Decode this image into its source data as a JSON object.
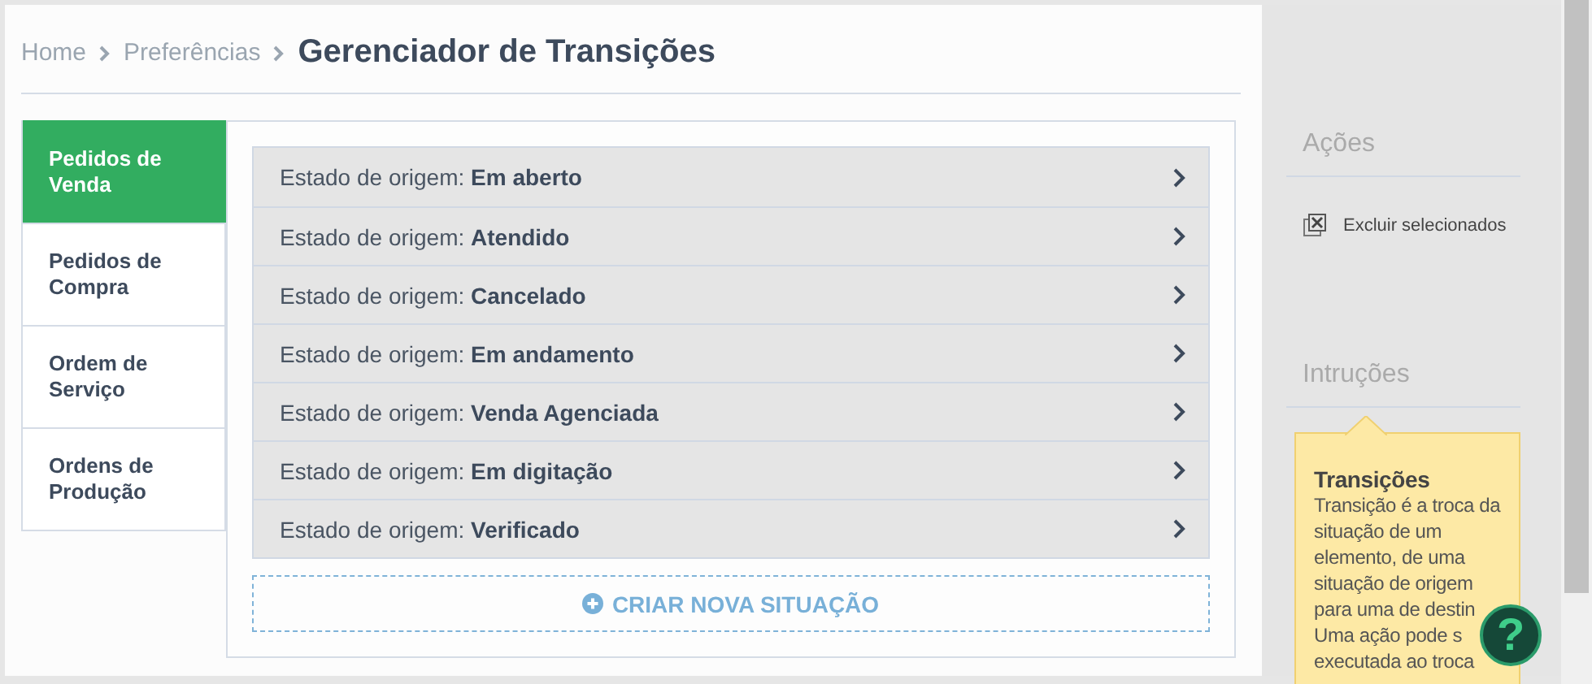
{
  "breadcrumb": {
    "items": [
      "Home",
      "Preferências"
    ],
    "title": "Gerenciador de Transições"
  },
  "tabs": [
    {
      "label": "Pedidos de Venda",
      "selected": true
    },
    {
      "label": "Pedidos de Compra",
      "selected": false
    },
    {
      "label": "Ordem de Serviço",
      "selected": false
    },
    {
      "label": "Ordens de Produção",
      "selected": false
    }
  ],
  "states": [
    {
      "prefix": "Estado de origem:",
      "name": "Em aberto"
    },
    {
      "prefix": "Estado de origem:",
      "name": "Atendido"
    },
    {
      "prefix": "Estado de origem:",
      "name": "Cancelado"
    },
    {
      "prefix": "Estado de origem:",
      "name": "Em andamento"
    },
    {
      "prefix": "Estado de origem:",
      "name": "Venda Agenciada"
    },
    {
      "prefix": "Estado de origem:",
      "name": "Em digitação"
    },
    {
      "prefix": "Estado de origem:",
      "name": "Verificado"
    }
  ],
  "create_button": "CRIAR NOVA SITUAÇÃO",
  "sidebar": {
    "actions_title": "Ações",
    "actions": [
      "Excluir selecionados"
    ],
    "instructions_title": "Intruções",
    "tip": {
      "title": "Transições",
      "blocks": [
        [
          "Transição é a troca da",
          "situação de um",
          "elemento, de uma",
          "situação de origem"
        ],
        [
          "para uma de destin",
          "Uma ação pode s",
          "executada ao troca"
        ]
      ]
    }
  },
  "help_button": "?"
}
